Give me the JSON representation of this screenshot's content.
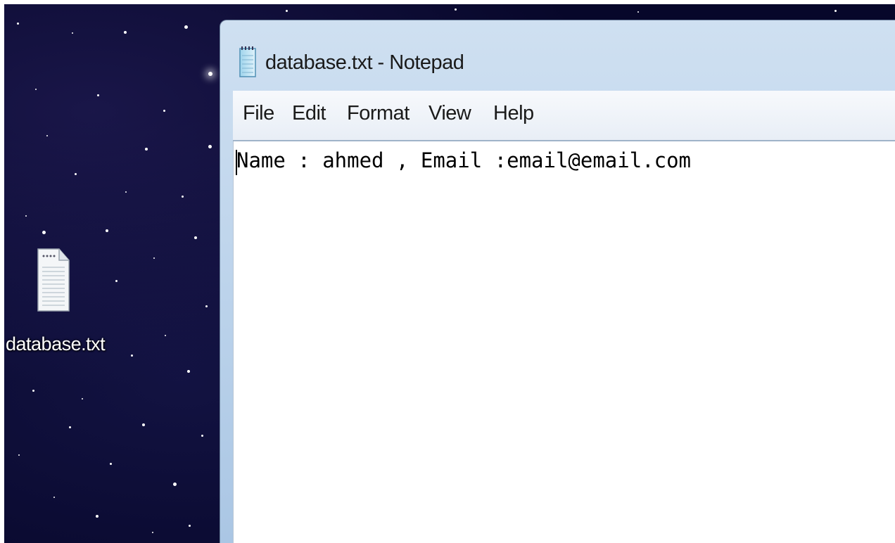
{
  "desktop": {
    "icon": {
      "label": "database.txt",
      "icon": "text-document-icon"
    }
  },
  "window": {
    "title": "database.txt - Notepad",
    "title_icon": "notepad-icon",
    "menu": [
      {
        "label": "File"
      },
      {
        "label": "Edit"
      },
      {
        "label": "Format"
      },
      {
        "label": "View"
      },
      {
        "label": "Help"
      }
    ],
    "content": {
      "text": "Name : ahmed , Email :email@email.com"
    }
  }
}
